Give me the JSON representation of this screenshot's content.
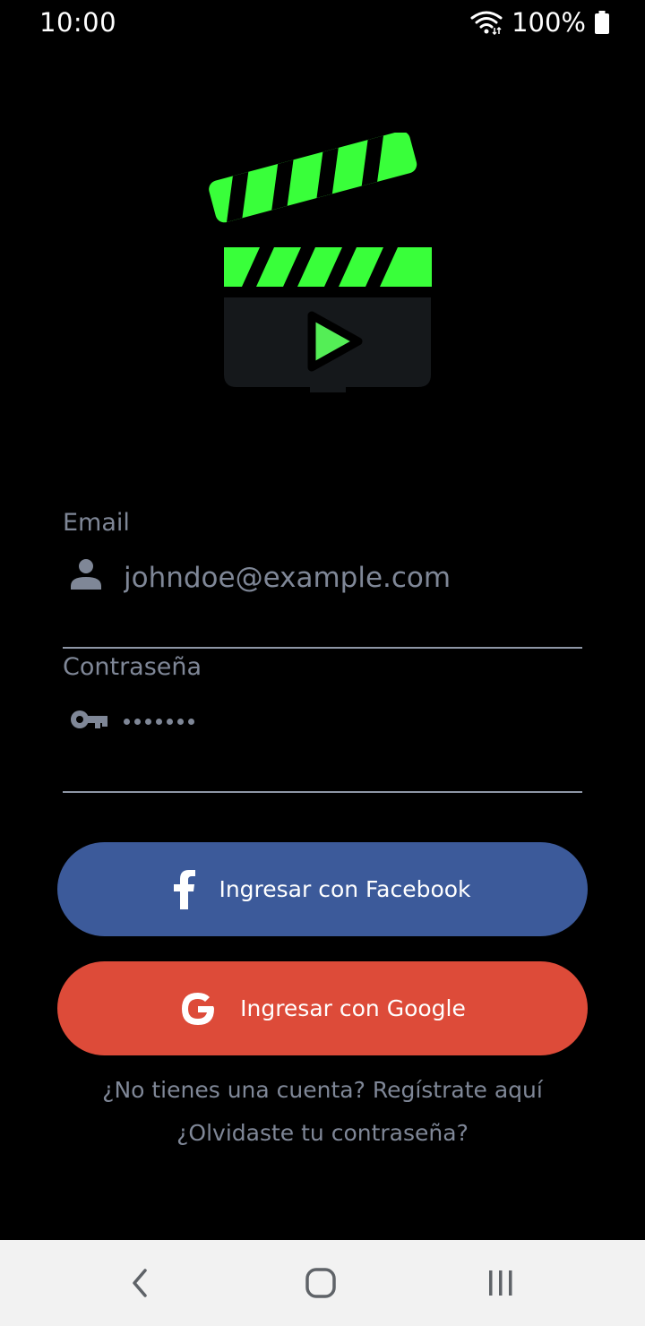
{
  "status_bar": {
    "time": "10:00",
    "battery": "100%",
    "icons": [
      "wifi-icon",
      "battery-icon"
    ]
  },
  "logo": {
    "icon": "clapperboard-play-icon",
    "colors": {
      "accent": "#39ff3a",
      "board": "#15181b",
      "play": "#54ee56"
    }
  },
  "form": {
    "email": {
      "label": "Email",
      "placeholder": "johndoe@example.com",
      "value": "",
      "icon": "person-icon"
    },
    "password": {
      "label": "Contraseña",
      "value": "•••••••",
      "icon": "key-icon"
    }
  },
  "buttons": {
    "facebook": {
      "label": "Ingresar con Facebook",
      "icon": "facebook-icon",
      "color": "#3c5a9a"
    },
    "google": {
      "label": "Ingresar con Google",
      "icon": "google-icon",
      "color": "#dd4b39"
    }
  },
  "links": {
    "register": "¿No tienes una cuenta? Regístrate aquí",
    "forgot_password": "¿Olvidaste tu contraseña?"
  },
  "nav_bar": {
    "icons": [
      "back-icon",
      "home-icon",
      "recents-icon"
    ]
  }
}
